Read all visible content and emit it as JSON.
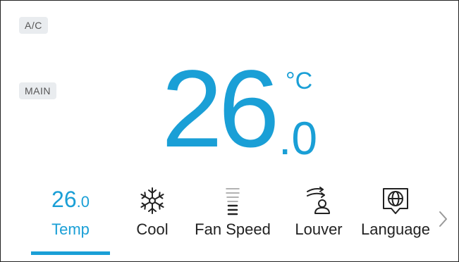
{
  "tags": {
    "ac": "A/C",
    "main": "MAIN"
  },
  "temperature": {
    "integer": "26",
    "decimal": ".0",
    "unit": "°C"
  },
  "tabs": [
    {
      "id": "temp",
      "label": "Temp",
      "mini_integer": "26",
      "mini_decimal": ".0",
      "active": true
    },
    {
      "id": "cool",
      "label": "Cool",
      "icon": "snowflake-icon",
      "active": false
    },
    {
      "id": "fan",
      "label": "Fan Speed",
      "icon": "fan-speed-icon",
      "active": false
    },
    {
      "id": "louver",
      "label": "Louver",
      "icon": "louver-icon",
      "active": false
    },
    {
      "id": "language",
      "label": "Language",
      "icon": "globe-icon",
      "active": false
    }
  ],
  "colors": {
    "accent": "#1a9fd6",
    "text": "#222222",
    "tag_bg": "#e9ecef"
  },
  "icons": {
    "next": "chevron-right-icon"
  }
}
